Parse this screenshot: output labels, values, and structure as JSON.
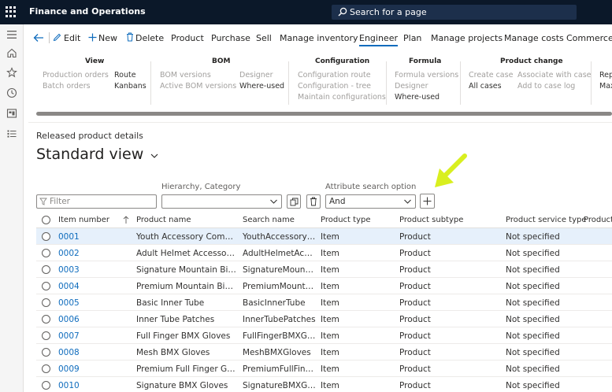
{
  "app": {
    "title": "Finance and Operations",
    "search_label": "Search for a page"
  },
  "actionbar": {
    "items": [
      "Edit",
      "New",
      "Delete",
      "Product",
      "Purchase",
      "Sell",
      "Manage inventory",
      "Engineer",
      "Plan",
      "Manage projects",
      "Manage costs",
      "Commerce"
    ],
    "active": "Engineer"
  },
  "ribbon": {
    "groups": [
      {
        "title": "View",
        "items": [
          "Production orders",
          "Batch orders",
          "Route",
          "Kanbans"
        ]
      },
      {
        "title": "BOM",
        "items": [
          "BOM versions",
          "Active BOM versions",
          "Designer",
          "Where-used"
        ]
      },
      {
        "title": "Configuration",
        "items": [
          "Configuration route",
          "Configuration - tree",
          "Maintain configurations"
        ]
      },
      {
        "title": "Formula",
        "items": [
          "Formula versions",
          "Designer",
          "Where-used"
        ]
      },
      {
        "title": "Product change",
        "items": [
          "Create case",
          "All cases",
          "Associate with case",
          "Add to case log"
        ]
      },
      {
        "title": "",
        "items": [
          "Rep",
          "Max"
        ]
      }
    ]
  },
  "page": {
    "breadcrumb": "Released product details",
    "view_name": "Standard view"
  },
  "filters": {
    "filter_placeholder": "Filter",
    "hierarchy_label": "Hierarchy, Category",
    "hierarchy_value": "",
    "attr_label": "Attribute search option",
    "attr_value": "And"
  },
  "grid": {
    "columns": [
      "Item number",
      "Product name",
      "Search name",
      "Product type",
      "Product subtype",
      "Product service type",
      "Product"
    ],
    "rows": [
      [
        "0001",
        "Youth Accessory Combo ...",
        "YouthAccessoryC...",
        "Item",
        "Product",
        "Not specified"
      ],
      [
        "0002",
        "Adult Helmet Accessory C...",
        "AdultHelmetAcce...",
        "Item",
        "Product",
        "Not specified"
      ],
      [
        "0003",
        "Signature Mountain Bike ...",
        "SignatureMountai...",
        "Item",
        "Product",
        "Not specified"
      ],
      [
        "0004",
        "Premium Mountain Bike T...",
        "PremiumMountai...",
        "Item",
        "Product",
        "Not specified"
      ],
      [
        "0005",
        "Basic Inner Tube",
        "BasicInnerTube",
        "Item",
        "Product",
        "Not specified"
      ],
      [
        "0006",
        "Inner Tube Patches",
        "InnerTubePatches",
        "Item",
        "Product",
        "Not specified"
      ],
      [
        "0007",
        "Full Finger BMX Gloves",
        "FullFingerBMXGlo...",
        "Item",
        "Product",
        "Not specified"
      ],
      [
        "0008",
        "Mesh BMX Gloves",
        "MeshBMXGloves",
        "Item",
        "Product",
        "Not specified"
      ],
      [
        "0009",
        "Premium Full Finger Gloves",
        "PremiumFullFinge...",
        "Item",
        "Product",
        "Not specified"
      ],
      [
        "0010",
        "Signature BMX Gloves",
        "SignatureBMXGlo...",
        "Item",
        "Product",
        "Not specified"
      ]
    ]
  },
  "colors": {
    "topbar": "#0b1829",
    "accent": "#0f6cbd",
    "annotation_arrow": "#d9ef1f"
  }
}
